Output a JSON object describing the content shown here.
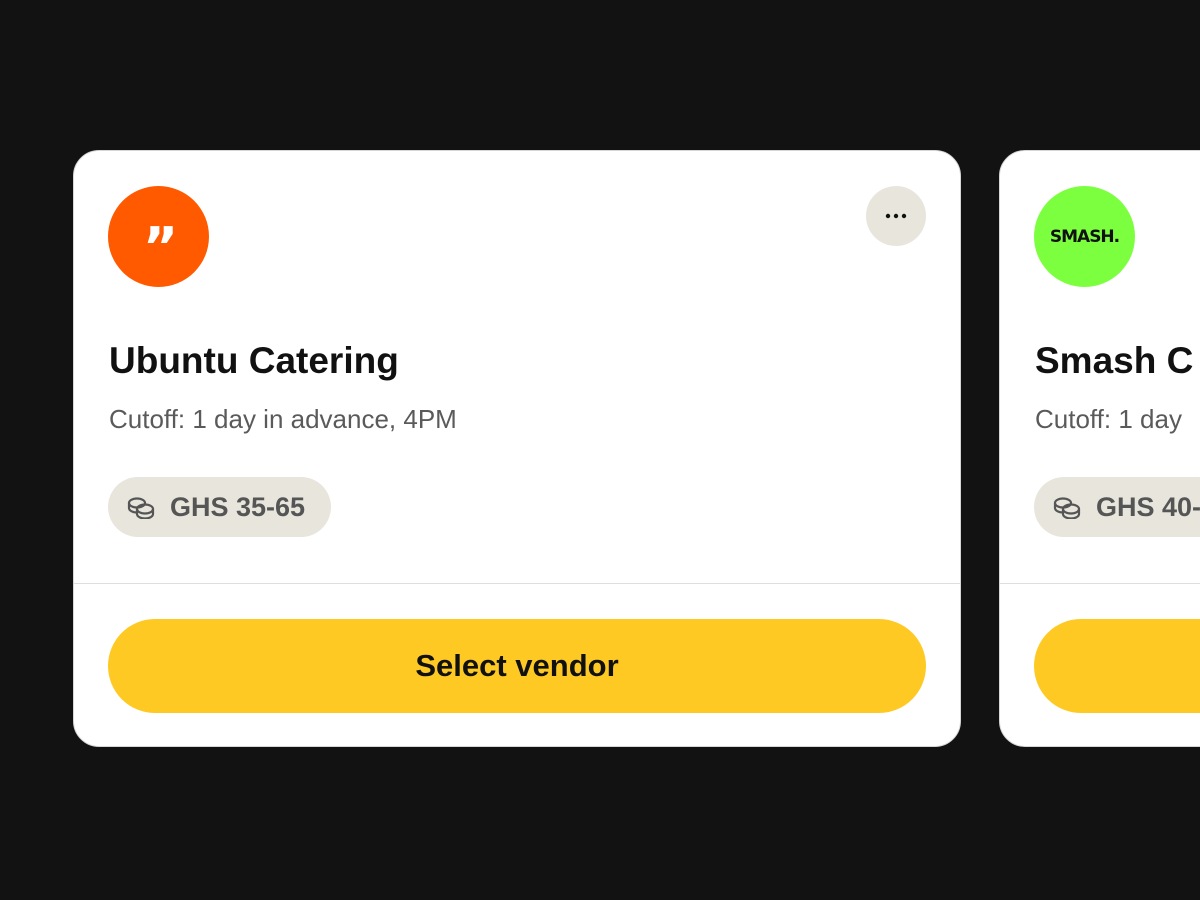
{
  "colors": {
    "background": "#121212",
    "card": "#ffffff",
    "chip": "#e8e5dc",
    "primary_button": "#fec923",
    "ubuntu_logo": "#ff5a00",
    "smash_logo": "#7cff3f"
  },
  "vendors": [
    {
      "name": "Ubuntu Catering",
      "logo": {
        "icon": "quote-mark-logo",
        "glyph": "”",
        "color": "#ff5a00"
      },
      "cutoff": "Cutoff: 1 day in advance, 4PM",
      "price_icon": "coins-icon",
      "price": "GHS 35-65",
      "more_icon": "ellipsis-icon",
      "button_label": "Select vendor"
    },
    {
      "name": "Smash C",
      "logo": {
        "icon": "smash-logo",
        "text": "SMASH.",
        "color": "#7cff3f"
      },
      "cutoff": "Cutoff: 1 day",
      "price_icon": "coins-icon",
      "price": "GHS 40-",
      "button_label": ""
    }
  ]
}
